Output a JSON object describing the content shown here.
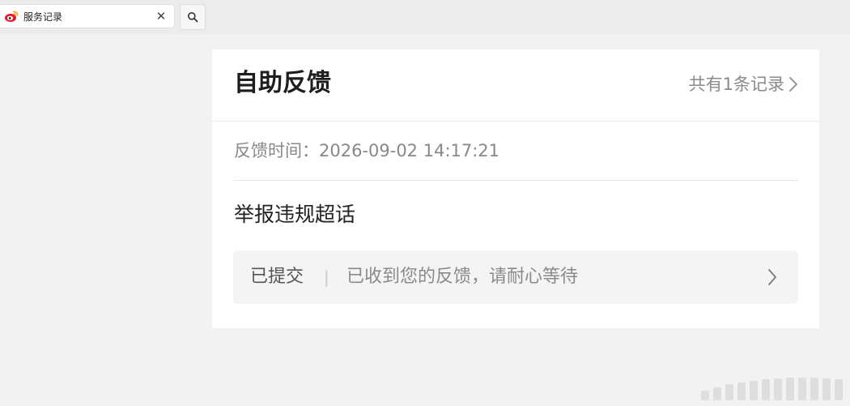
{
  "tab": {
    "title": "服务记录",
    "close_glyph": "✕",
    "favicon_icon": "weibo-icon",
    "search_icon": "search-icon"
  },
  "card": {
    "title": "自助反馈",
    "records_link": "共有1条记录",
    "feedback_time": "反馈时间：2026-09-02 14:17:21",
    "item_title": "举报违规超话",
    "status": {
      "label": "已提交",
      "separator": "|",
      "message": "已收到您的反馈，请耐心等待"
    }
  },
  "colors": {
    "background": "#f2f2f2",
    "card": "#ffffff",
    "status_bg": "#f4f4f5",
    "weibo_red": "#e6162d",
    "weibo_orange": "#f39c12"
  }
}
